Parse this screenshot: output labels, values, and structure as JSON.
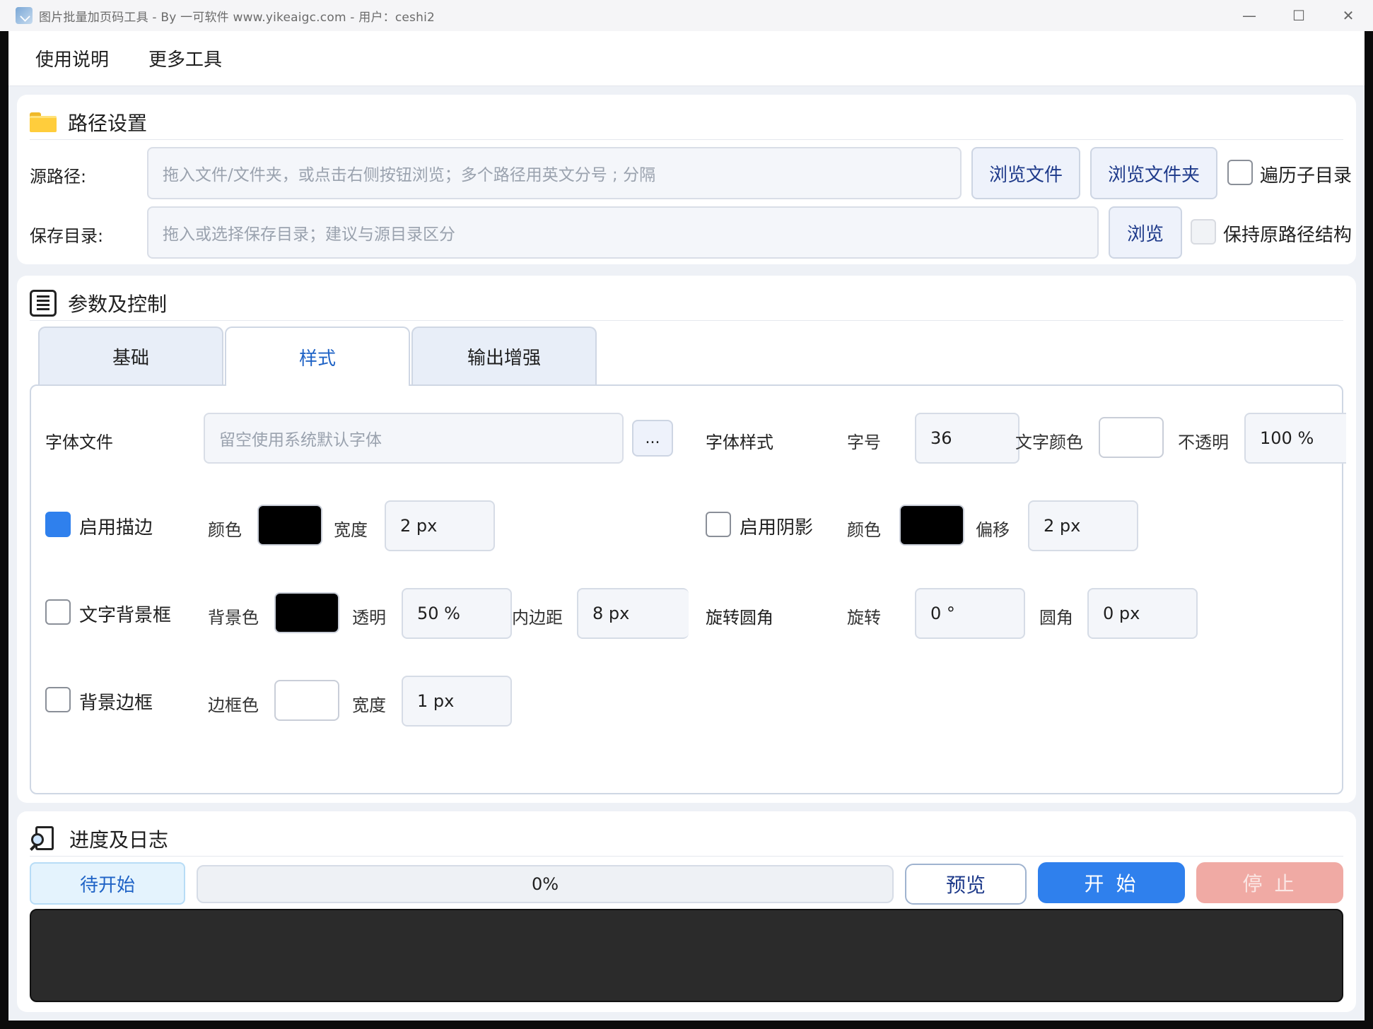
{
  "titlebar": {
    "title": "图片批量加页码工具 - By 一可软件 www.yikeaigc.com  -  用户：ceshi2",
    "minimize": "—",
    "maximize": "☐",
    "close": "✕"
  },
  "menu": {
    "items": [
      "使用说明",
      "更多工具"
    ]
  },
  "path_panel": {
    "title": "路径设置",
    "source_label": "源路径:",
    "source_placeholder": "拖入文件/文件夹，或点击右侧按钮浏览；多个路径用英文分号 ; 分隔",
    "browse_file": "浏览文件",
    "browse_folder": "浏览文件夹",
    "recurse_label": "遍历子目录",
    "recurse_checked": false,
    "save_label": "保存目录:",
    "save_placeholder": "拖入或选择保存目录；建议与源目录区分",
    "browse": "浏览",
    "keep_structure_label": "保持原路径结构",
    "keep_structure_checked": false,
    "keep_structure_disabled": true
  },
  "params_panel": {
    "title": "参数及控制",
    "tabs": [
      "基础",
      "样式",
      "输出增强"
    ],
    "active_tab": "样式",
    "style": {
      "font_file_label": "字体文件",
      "font_file_placeholder": "留空使用系统默认字体",
      "font_file_browse": "...",
      "font_style_label": "字体样式",
      "font_size_label": "字号",
      "font_size": "36",
      "text_color_label": "文字颜色",
      "text_color": "#ffffff",
      "opacity_label": "不透明",
      "opacity": "100 %",
      "stroke_enable_label": "启用描边",
      "stroke_enabled": true,
      "stroke_color_label": "颜色",
      "stroke_color": "#000000",
      "stroke_width_label": "宽度",
      "stroke_width": "2 px",
      "shadow_enable_label": "启用阴影",
      "shadow_enabled": false,
      "shadow_color_label": "颜色",
      "shadow_color": "#000000",
      "shadow_offset_label": "偏移",
      "shadow_offset": "2 px",
      "bg_box_label": "文字背景框",
      "bg_box_enabled": false,
      "bg_color_label": "背景色",
      "bg_color": "#000000",
      "bg_alpha_label": "透明",
      "bg_alpha": "50 %",
      "padding_label": "内边距",
      "padding": "8 px",
      "rotate_round_label": "旋转圆角",
      "rotate_label": "旋转",
      "rotate": "0 °",
      "radius_label": "圆角",
      "radius": "0 px",
      "bg_border_label": "背景边框",
      "bg_border_enabled": false,
      "border_color_label": "边框色",
      "border_color": "#ffffff",
      "border_width_label": "宽度",
      "border_width": "1 px"
    }
  },
  "progress_panel": {
    "title": "进度及日志",
    "status": "待开始",
    "progress_fraction": 0,
    "progress_text": "0%",
    "preview": "预览",
    "start": "开 始",
    "stop": "停 止",
    "log": ""
  },
  "colors": {
    "accent": "#2f80ed",
    "stop_disabled": "#f0aaa4",
    "log_bg": "#2b2b2b"
  }
}
